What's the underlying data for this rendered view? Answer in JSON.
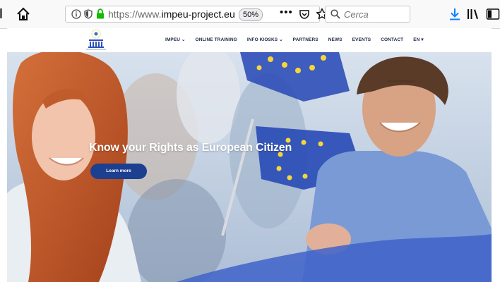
{
  "browser": {
    "url_prefix": "https://www.",
    "url_domain": "impeu-project.eu",
    "zoom": "50%",
    "overflow_menu": "•••",
    "search_placeholder": "Cerca",
    "icons": [
      "home-icon",
      "info-icon",
      "tracking-shield-icon",
      "lock-icon",
      "pocket-icon",
      "bookmark-star-icon",
      "search-icon",
      "download-icon",
      "library-icon",
      "sidebar-icon"
    ]
  },
  "site": {
    "logo_icon": "impeu-logo-icon",
    "nav": [
      {
        "label": "IMPEU ⌄"
      },
      {
        "label": "ONLINE TRAINING"
      },
      {
        "label": "INFO KIOSKS ⌄"
      },
      {
        "label": "PARTNERS"
      },
      {
        "label": "NEWS"
      },
      {
        "label": "EVENTS"
      },
      {
        "label": "CONTACT"
      },
      {
        "label": "EN ▾"
      }
    ]
  },
  "hero": {
    "title": "Know your Rights as European Citizen",
    "button_label": "Learn more",
    "colors": {
      "button": "#1d3f8f",
      "eu_blue": "#2d4fb8",
      "eu_star": "#f6d63a"
    }
  }
}
